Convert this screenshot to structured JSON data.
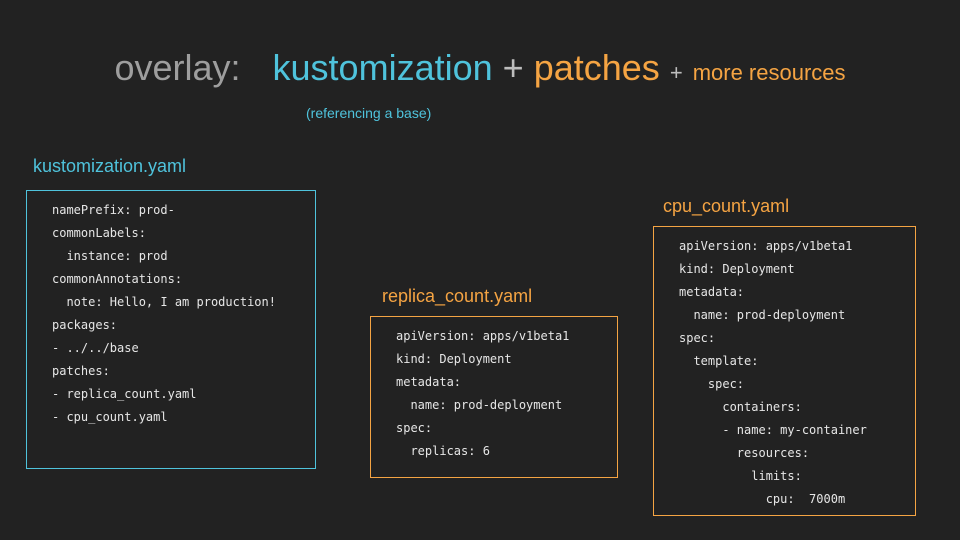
{
  "title": {
    "overlay": "overlay:",
    "kustomization": "kustomization",
    "plus": "+",
    "patches": "patches",
    "more_plus": "+",
    "more_resources": "more resources"
  },
  "subtitle": "(referencing a base)",
  "colors": {
    "background": "#222222",
    "cyan": "#4fc3dc",
    "orange": "#f5a443",
    "grey": "#9e9e9e",
    "code": "#e6e6e6"
  },
  "files": {
    "kustomization": {
      "name": "kustomization.yaml",
      "lines": [
        "namePrefix: prod-",
        "commonLabels:",
        "  instance: prod",
        "commonAnnotations:",
        "  note: Hello, I am production!",
        "packages:",
        "- ../../base",
        "patches:",
        "- replica_count.yaml",
        "- cpu_count.yaml"
      ]
    },
    "replica_count": {
      "name": "replica_count.yaml",
      "lines": [
        "apiVersion: apps/v1beta1",
        "kind: Deployment",
        "metadata:",
        "  name: prod-deployment",
        "spec:",
        "  replicas: 6"
      ]
    },
    "cpu_count": {
      "name": "cpu_count.yaml",
      "lines": [
        "apiVersion: apps/v1beta1",
        "kind: Deployment",
        "metadata:",
        "  name: prod-deployment",
        "spec:",
        "  template:",
        "    spec:",
        "      containers:",
        "      - name: my-container",
        "        resources:",
        "          limits:",
        "            cpu:  7000m"
      ]
    }
  }
}
